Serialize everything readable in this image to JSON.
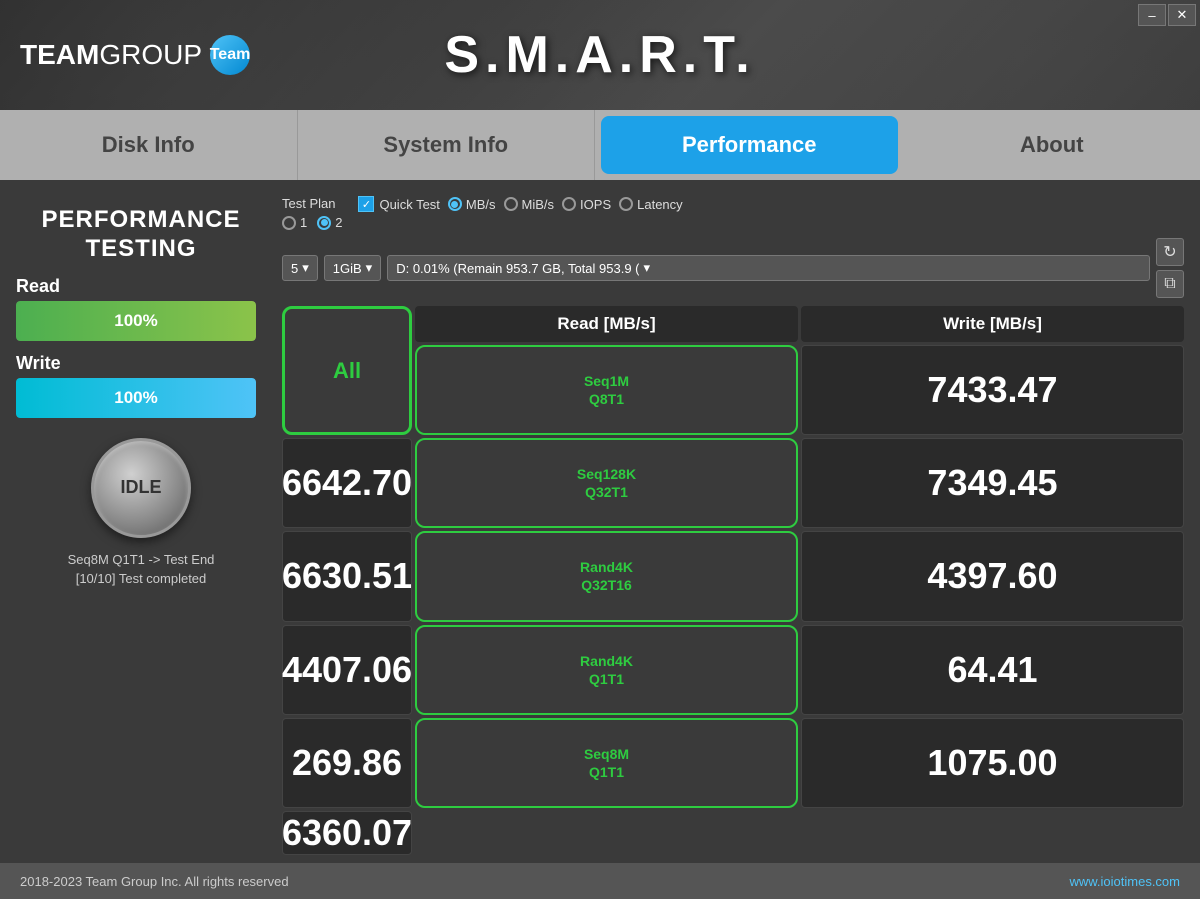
{
  "app": {
    "title": "S.M.A.R.T.",
    "logo_text_bold": "TEAM",
    "logo_text_light": "GROUP",
    "logo_circle": "Team",
    "minimize_label": "–",
    "close_label": "✕"
  },
  "tabs": [
    {
      "id": "disk-info",
      "label": "Disk Info",
      "active": false
    },
    {
      "id": "system-info",
      "label": "System Info",
      "active": false
    },
    {
      "id": "performance",
      "label": "Performance",
      "active": true
    },
    {
      "id": "about",
      "label": "About",
      "active": false
    }
  ],
  "left_panel": {
    "title": "PERFORMANCE\nTESTING",
    "read_label": "Read",
    "read_percent": "100%",
    "write_label": "Write",
    "write_percent": "100%",
    "idle_label": "IDLE",
    "status_line1": "Seq8M Q1T1 -> Test End",
    "status_line2": "[10/10] Test completed"
  },
  "controls": {
    "test_plan_label": "Test Plan",
    "radio_1_label": "1",
    "radio_2_label": "2",
    "radio_2_checked": true,
    "quick_test_label": "Quick Test",
    "quick_test_checked": true,
    "unit_options": [
      {
        "label": "MB/s",
        "checked": true
      },
      {
        "label": "MiB/s",
        "checked": false
      },
      {
        "label": "IOPS",
        "checked": false
      },
      {
        "label": "Latency",
        "checked": false
      }
    ],
    "queue_depth": "5",
    "block_size": "1GiB",
    "drive_path": "D:  0.01% (Remain 953.7 GB, Total 953.9 (",
    "refresh_icon": "↻",
    "copy_icon": "⧉"
  },
  "table": {
    "all_button_label": "All",
    "col_read": "Read [MB/s]",
    "col_write": "Write [MB/s]",
    "rows": [
      {
        "test": "Seq1M\nQ8T1",
        "read": "7433.47",
        "write": "6642.70"
      },
      {
        "test": "Seq128K\nQ32T1",
        "read": "7349.45",
        "write": "6630.51"
      },
      {
        "test": "Rand4K\nQ32T16",
        "read": "4397.60",
        "write": "4407.06"
      },
      {
        "test": "Rand4K\nQ1T1",
        "read": "64.41",
        "write": "269.86"
      },
      {
        "test": "Seq8M\nQ1T1",
        "read": "1075.00",
        "write": "6360.07"
      }
    ]
  },
  "footer": {
    "copyright": "2018-2023 Team Group Inc. All rights reserved",
    "website": "www.ioiotimes.com"
  }
}
